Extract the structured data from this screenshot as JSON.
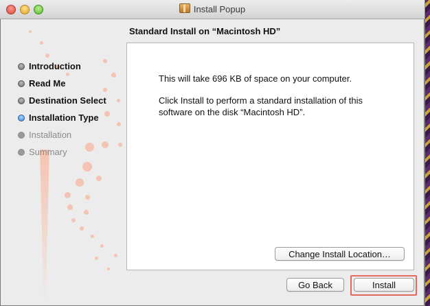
{
  "window": {
    "title": "Install Popup"
  },
  "heading": "Standard Install on “Macintosh HD”",
  "steps": [
    {
      "label": "Introduction",
      "state": "done"
    },
    {
      "label": "Read Me",
      "state": "done"
    },
    {
      "label": "Destination Select",
      "state": "done"
    },
    {
      "label": "Installation Type",
      "state": "current"
    },
    {
      "label": "Installation",
      "state": "future"
    },
    {
      "label": "Summary",
      "state": "future"
    }
  ],
  "panel": {
    "space_message": "This will take 696 KB of space on your computer.",
    "install_message": "Click Install to perform a standard installation of this software on the disk “Macintosh HD”.",
    "change_location_label": "Change Install Location…"
  },
  "buttons": {
    "go_back": "Go Back",
    "install": "Install"
  },
  "icons": {
    "window_icon": "package-icon",
    "close": "close-icon",
    "minimize": "minimize-icon",
    "zoom": "zoom-icon"
  },
  "colors": {
    "highlight_ring": "#e06a5c",
    "current_step": "#3a86d6"
  }
}
